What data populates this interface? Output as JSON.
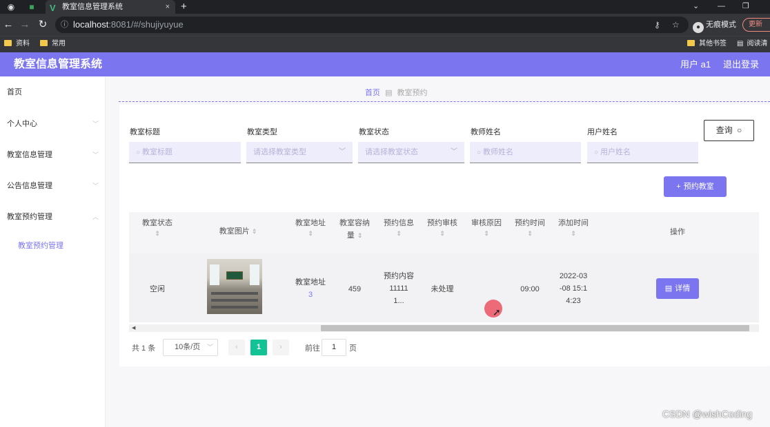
{
  "browser": {
    "tab_title": "教室信息管理系统",
    "tab_close": "×",
    "new_tab": "+",
    "url_host": "localhost",
    "url_rest": ":8081/#/shujiyuyue",
    "profile_label": "无痕模式",
    "update_label": "更新",
    "bookmarks": [
      "资料",
      "常用",
      "其他书签",
      "阅读清"
    ]
  },
  "app": {
    "title": "教室信息管理系统",
    "user_label": "用户 a1",
    "logout_label": "退出登录"
  },
  "sidebar": {
    "items": [
      {
        "label": "首页"
      },
      {
        "label": "个人中心"
      },
      {
        "label": "教室信息管理"
      },
      {
        "label": "公告信息管理"
      },
      {
        "label": "教室预约管理"
      }
    ],
    "sub_item": "教室预约管理"
  },
  "breadcrumb": {
    "home": "首页",
    "current": "教室预约"
  },
  "filters": [
    {
      "label": "教室标题",
      "placeholder": "教室标题",
      "icon": "search-icon"
    },
    {
      "label": "教室类型",
      "placeholder": "请选择教室类型",
      "icon": "chevron-down-icon"
    },
    {
      "label": "教室状态",
      "placeholder": "请选择教室状态",
      "icon": "chevron-down-icon"
    },
    {
      "label": "教师姓名",
      "placeholder": "教师姓名",
      "icon": "search-icon"
    },
    {
      "label": "用户姓名",
      "placeholder": "用户姓名",
      "icon": "search-icon"
    }
  ],
  "query_label": "查询",
  "reserve_label": "预约教室",
  "table": {
    "headers": [
      "教室状态",
      "教室图片",
      "教室地址",
      "教室容纳量",
      "预约信息",
      "预约审核",
      "审核原因",
      "预约时间",
      "添加时间",
      "操作"
    ],
    "header_capacity_line1": "教室容纳",
    "header_capacity_line2": "量",
    "row": {
      "status": "空闲",
      "address_line1": "教室地址",
      "address_line2": "3",
      "capacity": "459",
      "info_line1": "预约内容",
      "info_line2": "11111",
      "info_line3": "1...",
      "review": "未处理",
      "reason": "",
      "time": "09:00",
      "added_line1": "2022-03",
      "added_line2": "-08 15:1",
      "added_line3": "4:23",
      "detail_label": "详情"
    }
  },
  "pagination": {
    "total": "共 1 条",
    "page_size": "10条/页",
    "current": "1",
    "goto_label": "前往",
    "goto_value": "1",
    "unit": "页"
  },
  "watermark": "CSDN @wishCoding",
  "colors": {
    "accent": "#7b76f0",
    "page_active": "#13c295"
  }
}
